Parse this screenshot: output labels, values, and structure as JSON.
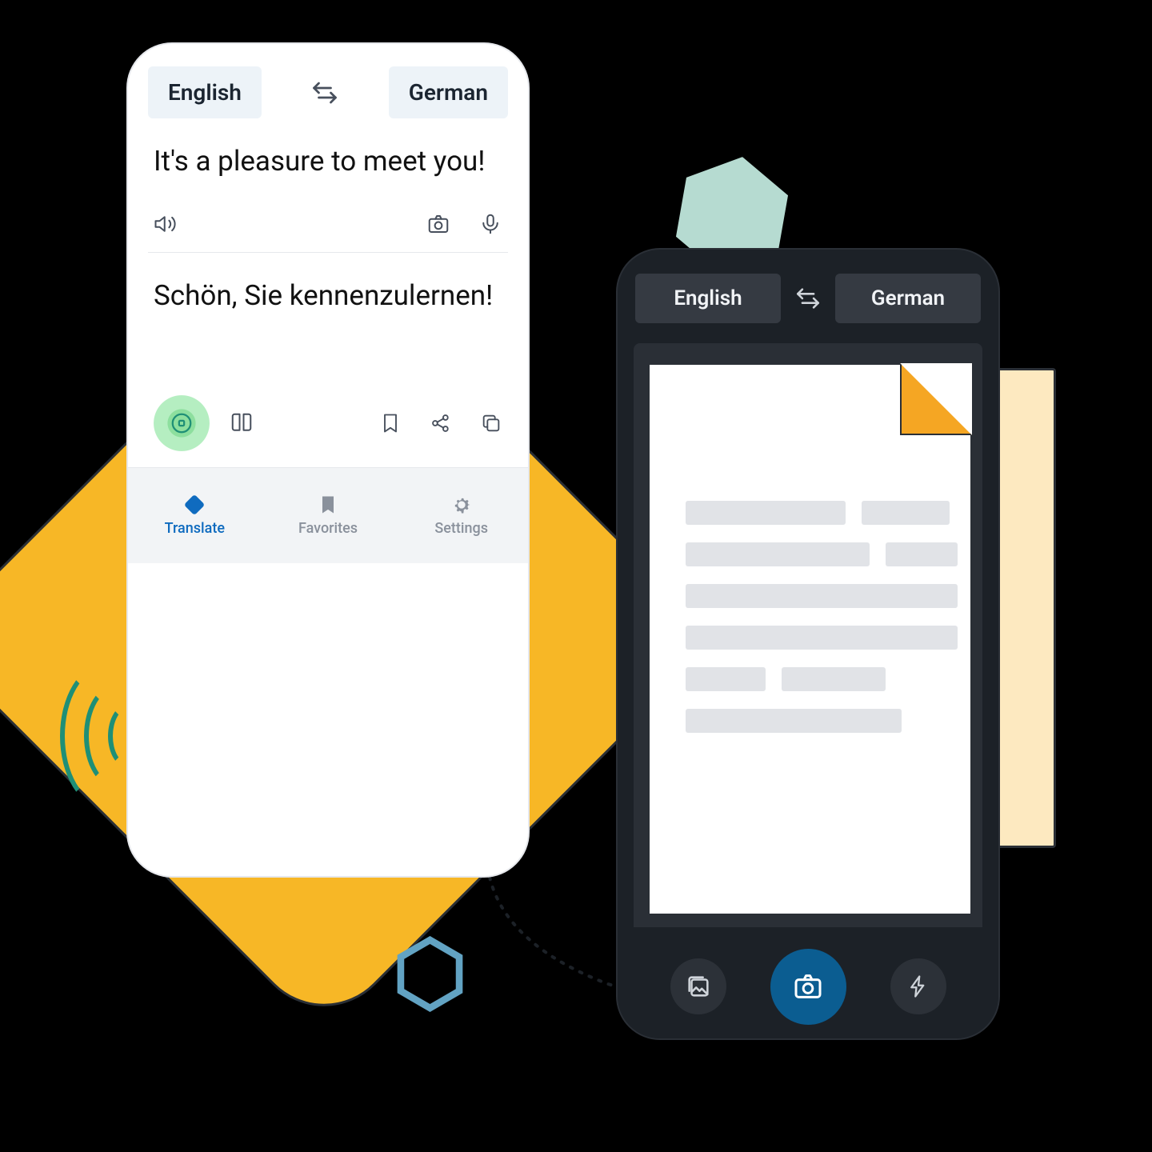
{
  "left_phone": {
    "source_lang": "English",
    "target_lang": "German",
    "source_text": "It's a pleasure to meet you!",
    "target_text": "Schön, Sie kennenzulernen!",
    "nav": {
      "translate": "Translate",
      "favorites": "Favorites",
      "settings": "Settings"
    }
  },
  "right_phone": {
    "source_lang": "English",
    "target_lang": "German"
  },
  "colors": {
    "accent_yellow": "#f7b726",
    "accent_teal": "#b6dbd1",
    "accent_blue": "#0b5d91",
    "accent_green": "#1f8f76"
  }
}
